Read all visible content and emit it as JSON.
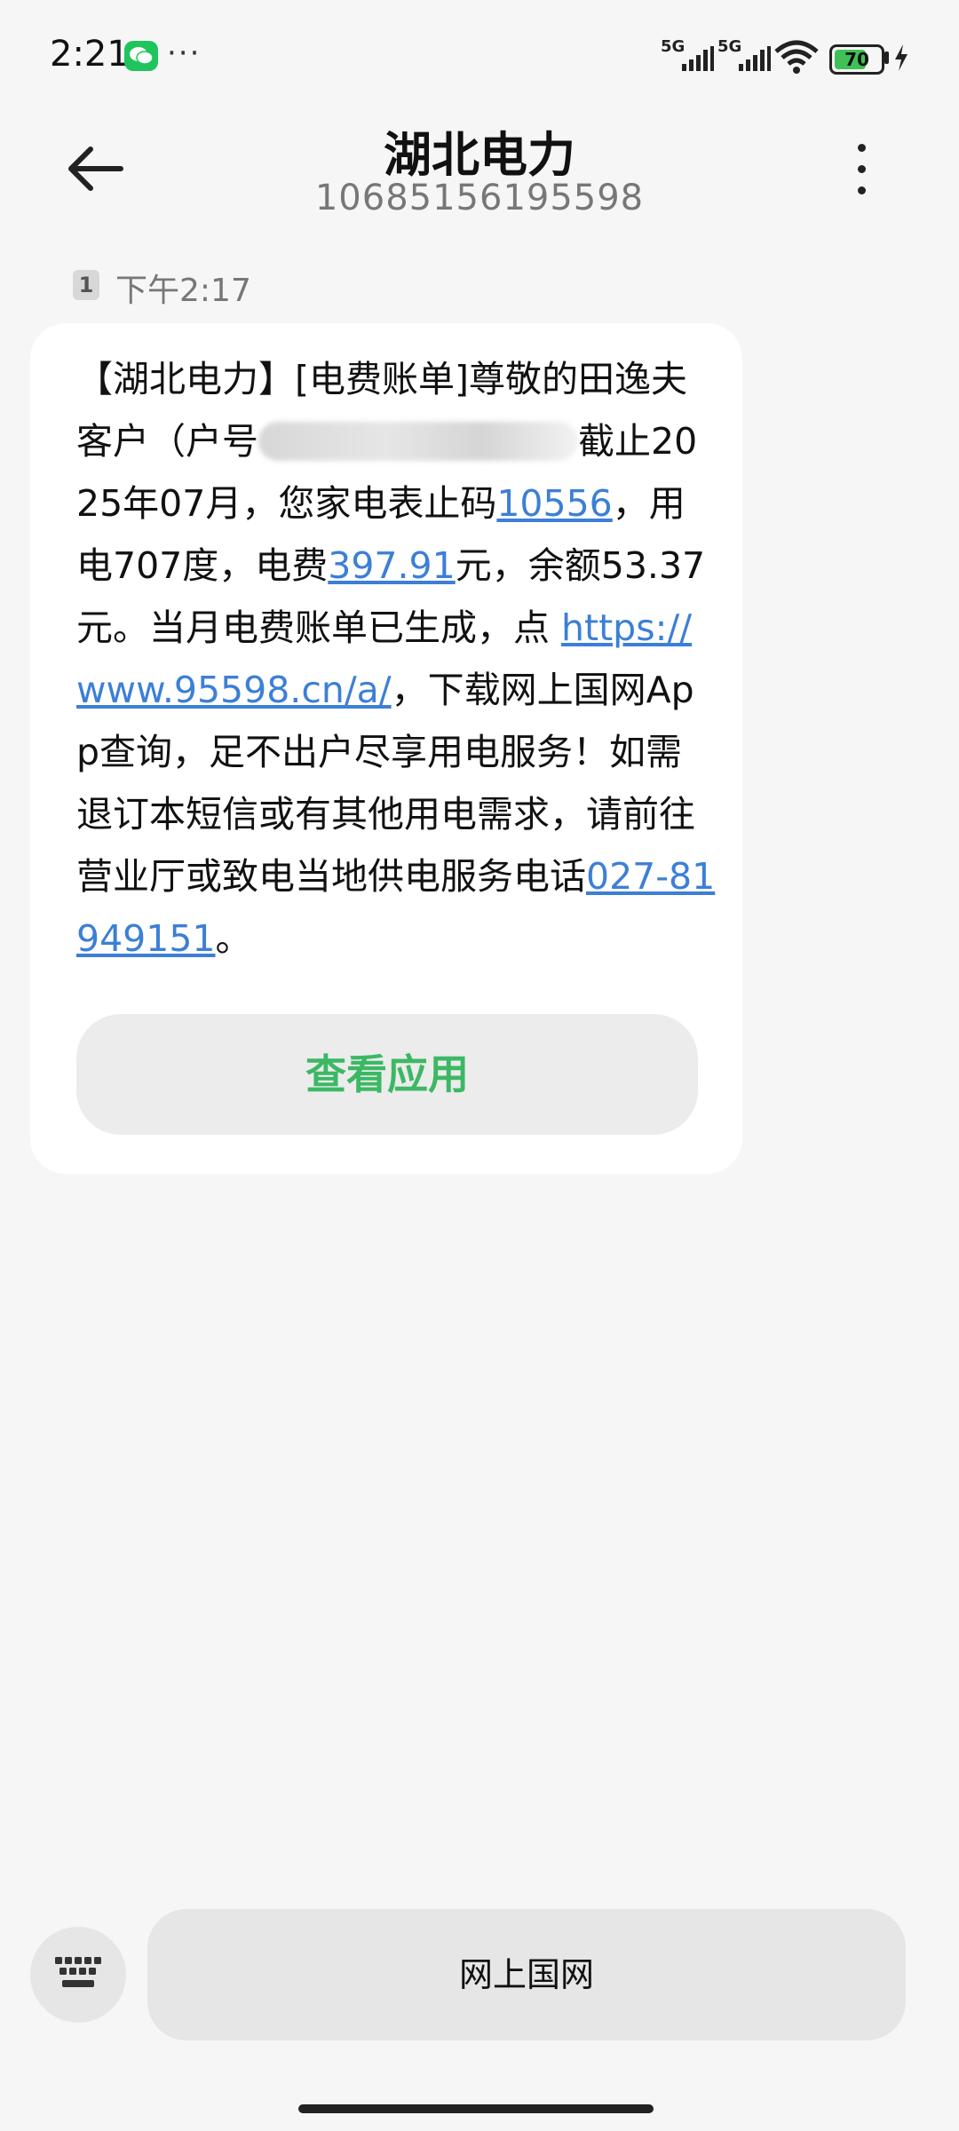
{
  "status_bar": {
    "time": "2:21",
    "more": "···",
    "signal_1": "5G",
    "signal_2": "5G",
    "battery": "70",
    "battery_level_percent": 70
  },
  "header": {
    "title": "湖北电力",
    "number": "10685156195598"
  },
  "message": {
    "sim": "1",
    "time": "下午2:17",
    "part1": "【湖北电力】[电费账单]尊敬的田逸夫客户（户号",
    "part2": "截止2025年07月，您家电表止码",
    "meter": "10556",
    "part3": "，用电707度，电费",
    "fee": "397.91",
    "part4": "元，余额53.37元。当月电费账单已生成，点 ",
    "link": "https://www.95598.cn/a/",
    "part5": "，下载网上国网App查询，足不出户尽享用电服务！如需退订本短信或有其他用电需求，请前往营业厅或致电当地供电服务电话",
    "phone": "027-81949151",
    "part6": "。",
    "action_button": "查看应用"
  },
  "bottom": {
    "quick_reply": "网上国网"
  },
  "colors": {
    "link": "#3c7fd6",
    "action_text": "#3cb864",
    "background": "#f6f6f6"
  }
}
